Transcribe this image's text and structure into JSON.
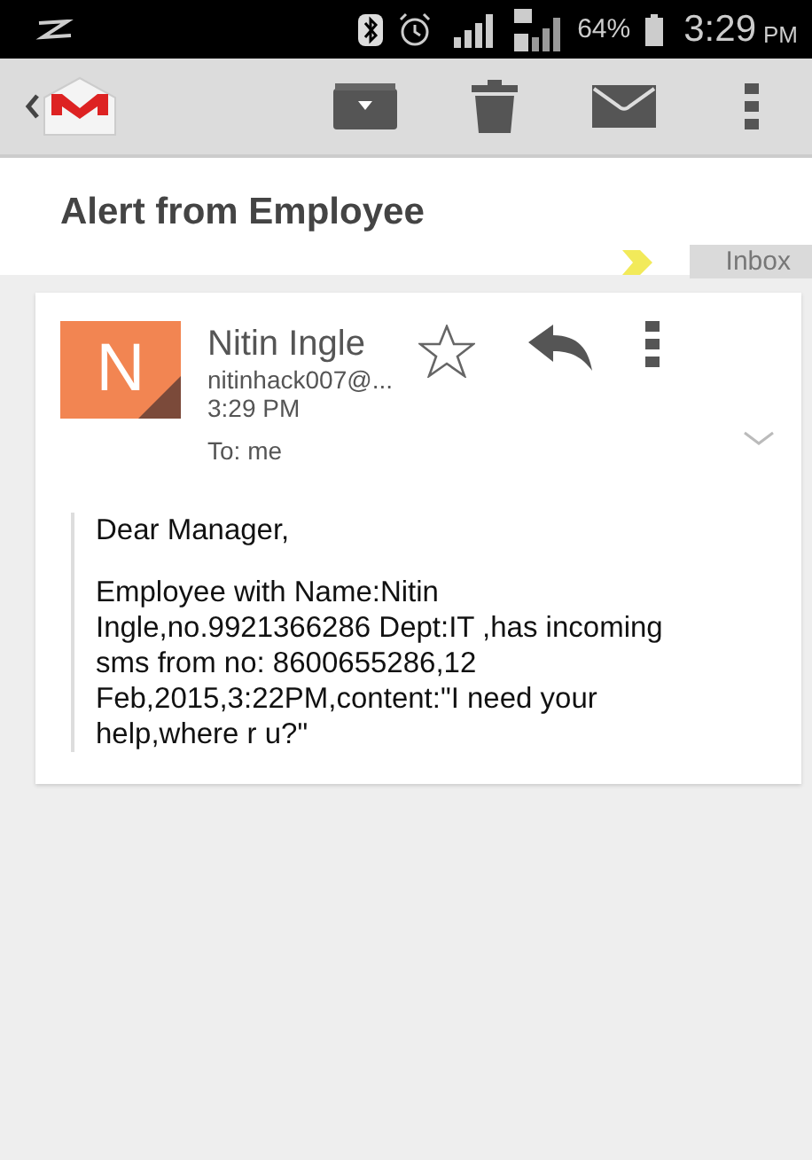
{
  "status_bar": {
    "battery": "64%",
    "time": "3:29",
    "ampm": "PM"
  },
  "subject": "Alert from Employee",
  "label": "Inbox",
  "message": {
    "avatar_letter": "N",
    "sender": "Nitin Ingle",
    "email": "nitinhack007@...",
    "time": "3:29 PM",
    "to": "To: me",
    "starred": false,
    "paragraphs": [
      [
        "Dear Manager,"
      ],
      [
        "Employee with Name:Nitin",
        "Ingle,no.9921366286 Dept:IT ,has incoming",
        "sms from no: 8600655286,12",
        "Feb,2015,3:22PM,content:\"I need your",
        "help,where r u?\""
      ]
    ]
  }
}
